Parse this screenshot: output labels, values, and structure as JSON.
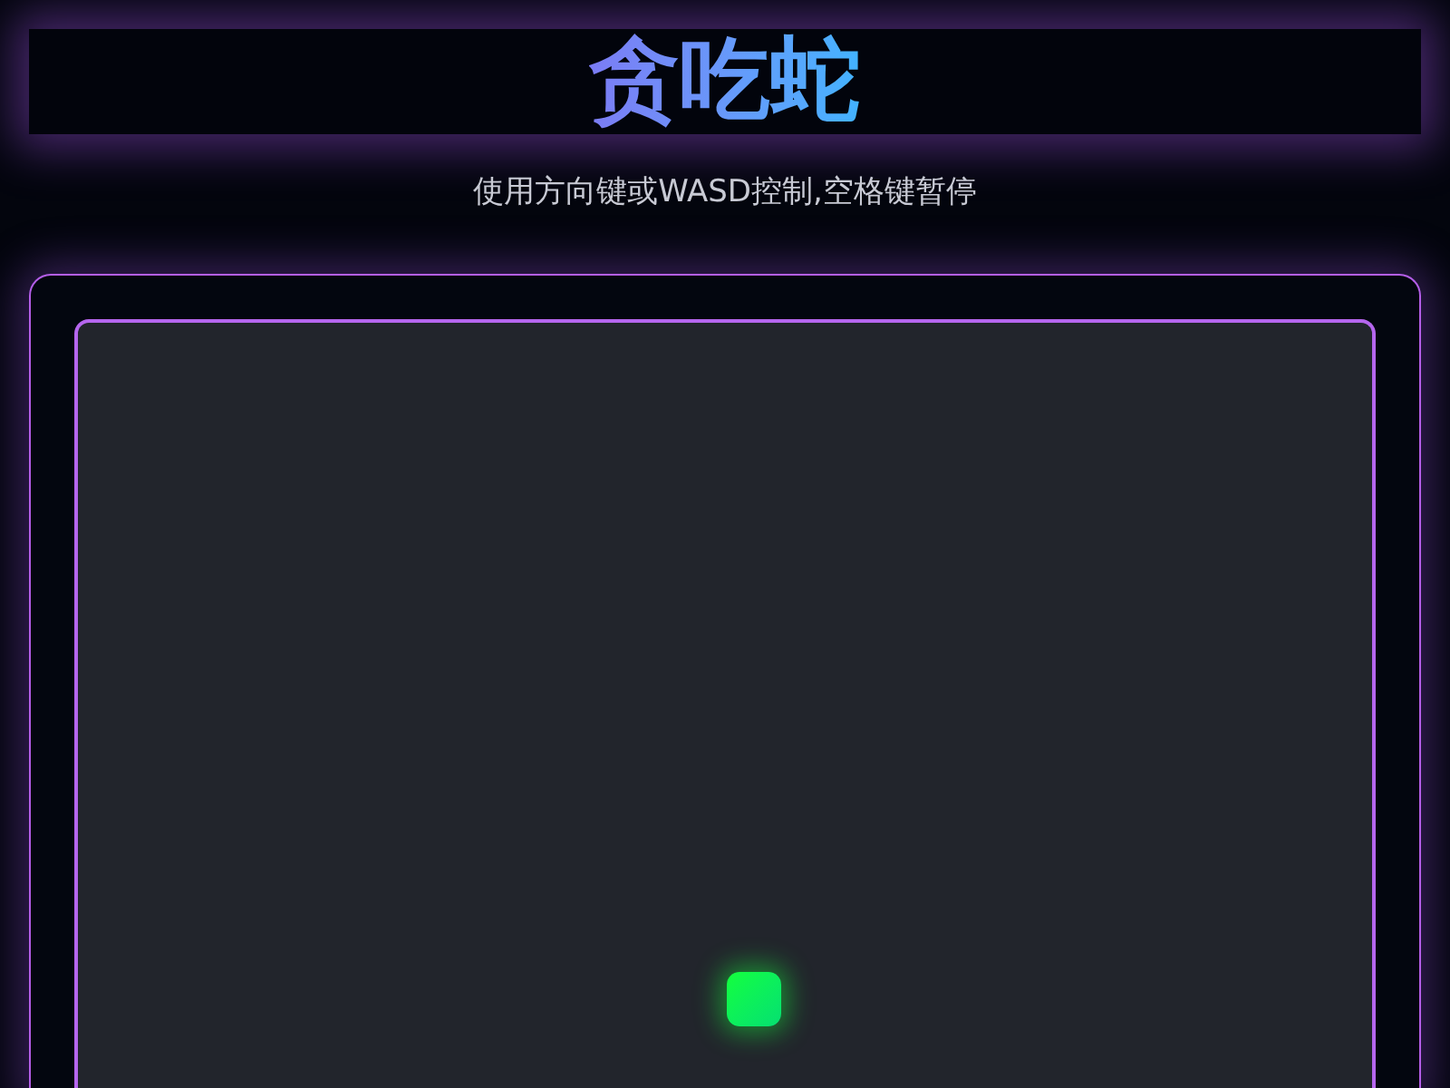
{
  "header": {
    "title": "贪吃蛇",
    "subtitle": "使用方向键或WASD控制,空格键暂停"
  },
  "board": {
    "snake": [
      {
        "kind": "head"
      }
    ]
  }
}
